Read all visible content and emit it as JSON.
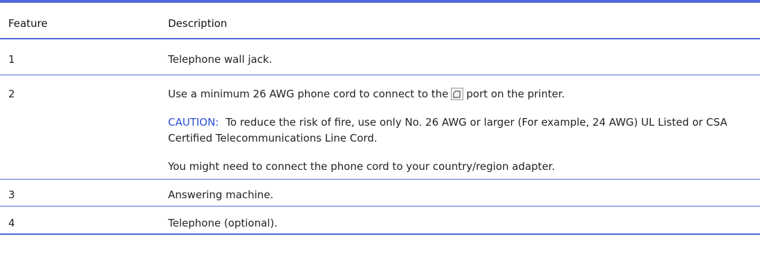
{
  "table": {
    "headers": {
      "feature": "Feature",
      "description": "Description"
    },
    "rows": [
      {
        "feature": "1",
        "description": "Telephone wall jack."
      },
      {
        "feature": "2",
        "description_before_icon": "Use a minimum 26 AWG phone cord to connect to the",
        "port_icon": "phone-port-icon",
        "description_after_icon": "port on the printer.",
        "caution_label": "CAUTION:",
        "caution_text": "To reduce the risk of fire, use only No. 26 AWG or larger (For example, 24 AWG) UL Listed or CSA Certified Telecommunications Line Cord.",
        "note": "You might need to connect the phone cord to your country/region adapter."
      },
      {
        "feature": "3",
        "description": "Answering machine."
      },
      {
        "feature": "4",
        "description": "Telephone (optional)."
      }
    ]
  },
  "colors": {
    "rule": "#4f66d8",
    "caution": "#2a4fd6"
  }
}
